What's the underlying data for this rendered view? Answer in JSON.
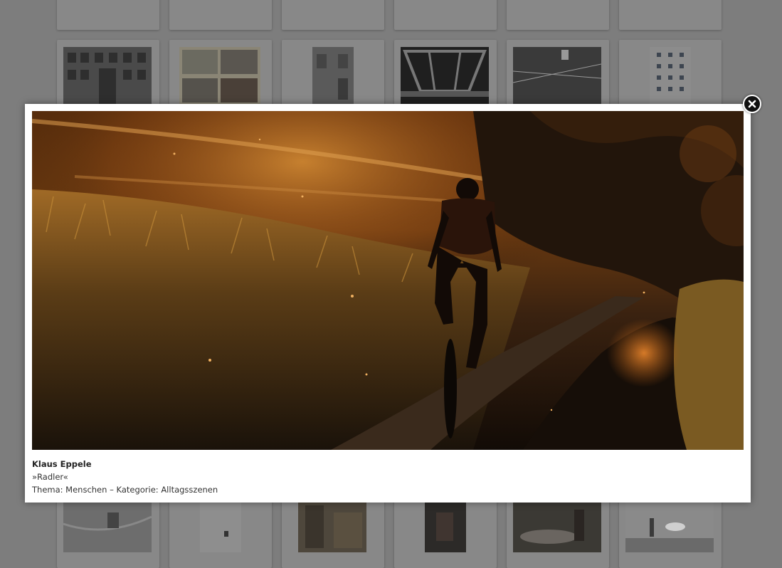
{
  "overlay": {
    "background_color": "#7d7d7d"
  },
  "lightbox": {
    "author": "Klaus Eppele",
    "title": "»Radler«",
    "meta": "Thema: Menschen – Kategorie: Alltagsszenen",
    "close_icon": "close-icon"
  },
  "gallery": {
    "tile_color": "#888888"
  }
}
